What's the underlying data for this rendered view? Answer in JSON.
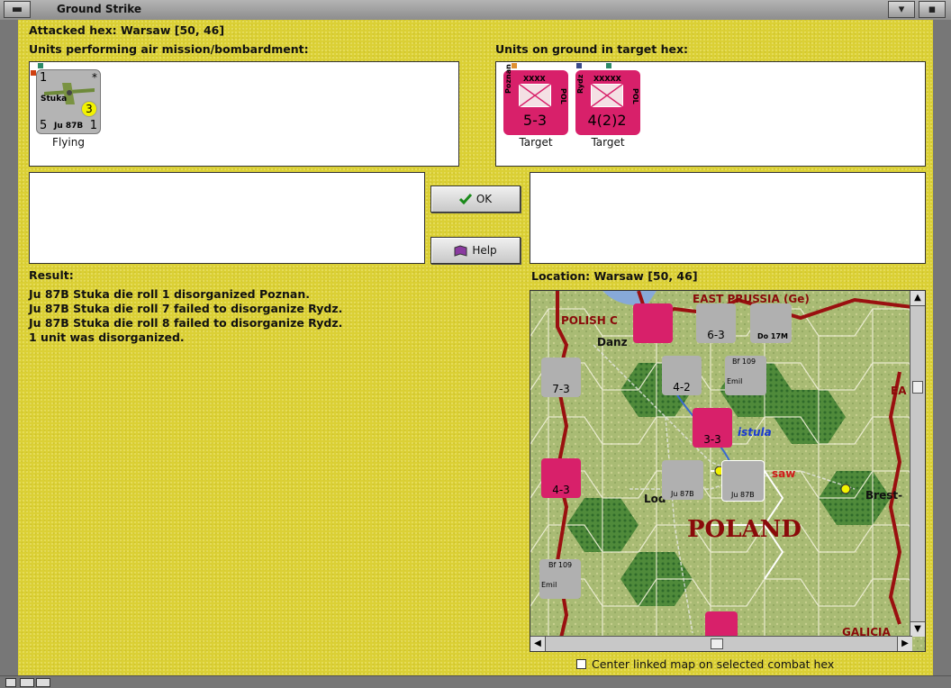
{
  "window": {
    "title": "Ground Strike"
  },
  "header": {
    "attacked_hex": "Attacked hex: Warsaw  [50, 46]"
  },
  "air_panel": {
    "label": "Units performing air mission/bombardment:",
    "units": [
      {
        "name": "Stuka",
        "model": "Ju 87B",
        "top_left": "1",
        "bottom_left": "5",
        "bottom_right": "1",
        "badge": "3",
        "star": "*",
        "caption": "Flying"
      }
    ]
  },
  "ground_panel": {
    "label": "Units on ground in target hex:",
    "units": [
      {
        "side_name": "Poznan",
        "nation": "POL",
        "size": "XXXX",
        "strength": "5-3",
        "caption": "Target"
      },
      {
        "side_name": "Rydz",
        "nation": "POL",
        "size": "XXXXX",
        "strength": "4(2)2",
        "caption": "Target"
      }
    ]
  },
  "buttons": {
    "ok": "OK",
    "help": "Help"
  },
  "result": {
    "label": "Result:",
    "lines": [
      "Ju 87B Stuka die roll 1 disorganized Poznan.",
      "Ju 87B Stuka die roll 7 failed to disorganize Rydz.",
      "Ju 87B Stuka die roll 8 failed to disorganize Rydz.",
      "1 unit was disorganized."
    ]
  },
  "location": {
    "label": "Location:  Warsaw  [50, 46]",
    "map_labels": {
      "east_prussia": "EAST PRUSSIA (Ge)",
      "polish_corridor": "POLISH C",
      "danzig": "Danz",
      "vistula": "istula",
      "warsaw": "saw",
      "lodz": "Lod",
      "poland": "POLAND",
      "brest": "Brest-",
      "galicia": "GALICIA",
      "ea": "EA"
    },
    "map_counters": [
      {
        "label": "6-3",
        "type": "xxx"
      },
      {
        "label": "7-3",
        "type": "xxx"
      },
      {
        "label": "4-2",
        "type": "xx"
      },
      {
        "label": "3-3",
        "type": "xxxx"
      },
      {
        "label": "4-3",
        "type": "xxxx"
      },
      {
        "label": "Ju 87B",
        "type": "air"
      },
      {
        "label": "Do 17M",
        "type": "air"
      },
      {
        "label": "Bf 109",
        "type": "air"
      },
      {
        "label": "Emil",
        "type": "air"
      }
    ]
  },
  "options": {
    "center_linked_map": "Center linked map on selected combat hex"
  },
  "colors": {
    "dialog_bg": "#dbd035",
    "polish_unit": "#d8206a",
    "german_unit": "#b0b0b0",
    "border_red": "#9a1010"
  }
}
